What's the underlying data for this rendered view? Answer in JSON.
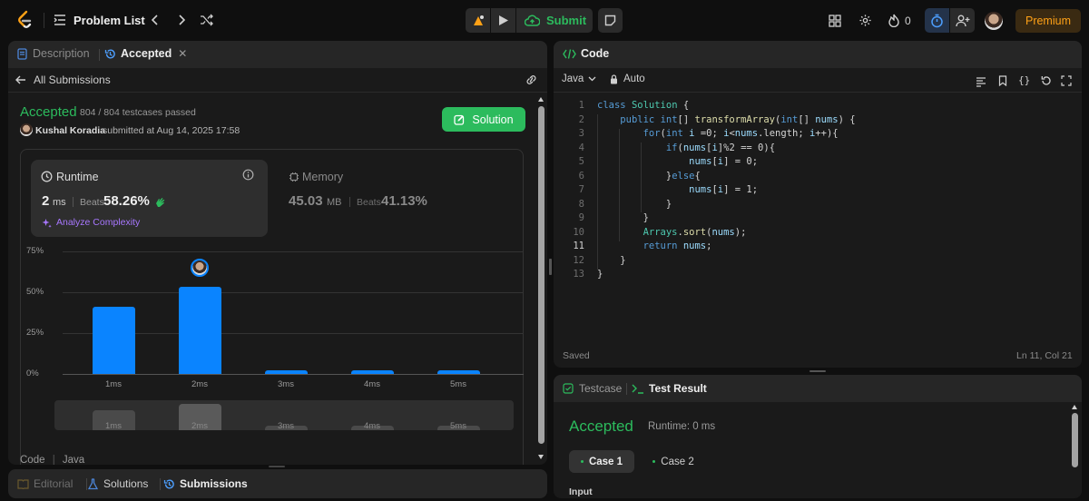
{
  "topbar": {
    "problem_list": "Problem List",
    "submit": "Submit",
    "streak": "0",
    "premium": "Premium"
  },
  "left_panel": {
    "tabs": {
      "description": "Description",
      "accepted": "Accepted"
    },
    "back_label": "All Submissions",
    "status": "Accepted",
    "testcases": "804 / 804 testcases passed",
    "author": "Kushal Koradia",
    "submitted_at": "submitted at Aug 14, 2025 17:58",
    "solution_button": "Solution",
    "runtime": {
      "title": "Runtime",
      "value": "2",
      "unit": "ms",
      "beats_label": "Beats",
      "beats_value": "58.26%",
      "analyze": "Analyze Complexity"
    },
    "memory": {
      "title": "Memory",
      "value": "45.03",
      "unit": "MB",
      "beats_label": "Beats",
      "beats_value": "41.13%"
    },
    "code_lang": {
      "code": "Code",
      "lang": "Java"
    },
    "bottom_tabs": {
      "editorial": "Editorial",
      "solutions": "Solutions",
      "submissions": "Submissions"
    }
  },
  "chart_data": {
    "type": "bar",
    "categories": [
      "1ms",
      "2ms",
      "3ms",
      "4ms",
      "5ms"
    ],
    "values": [
      41,
      53.5,
      2,
      2,
      2
    ],
    "y_ticks": [
      "75%",
      "50%",
      "25%",
      "0%"
    ],
    "ylim": [
      0,
      75
    ],
    "highlight_index": 1,
    "overview_categories": [
      "1ms",
      "2ms",
      "3ms",
      "4ms",
      "5ms"
    ],
    "overview_values": [
      41,
      53.5,
      2,
      2,
      2
    ]
  },
  "editor": {
    "title": "Code",
    "language": "Java",
    "mode": "Auto",
    "lines": [
      "class Solution {",
      "    public int[] transformArray(int[] nums) {",
      "        for(int i =0; i<nums.length; i++){",
      "            if(nums[i]%2 == 0){",
      "                nums[i] = 0;",
      "            }else{",
      "                nums[i] = 1;",
      "            }",
      "        }",
      "        Arrays.sort(nums);",
      "        return nums;",
      "    }",
      "}"
    ],
    "line_numbers": [
      "1",
      "2",
      "3",
      "4",
      "5",
      "6",
      "7",
      "8",
      "9",
      "10",
      "11",
      "12",
      "13"
    ],
    "saved": "Saved",
    "cursor": "Ln 11, Col 21"
  },
  "result_panel": {
    "tab_testcase": "Testcase",
    "tab_result": "Test Result",
    "status": "Accepted",
    "runtime": "Runtime: 0 ms",
    "case1": "Case 1",
    "case2": "Case 2",
    "input": "Input"
  },
  "colors": {
    "accent_green": "#2cbb5d",
    "bar_blue": "#0a84ff",
    "premium": "#ffa116",
    "purple": "#a877ff"
  }
}
